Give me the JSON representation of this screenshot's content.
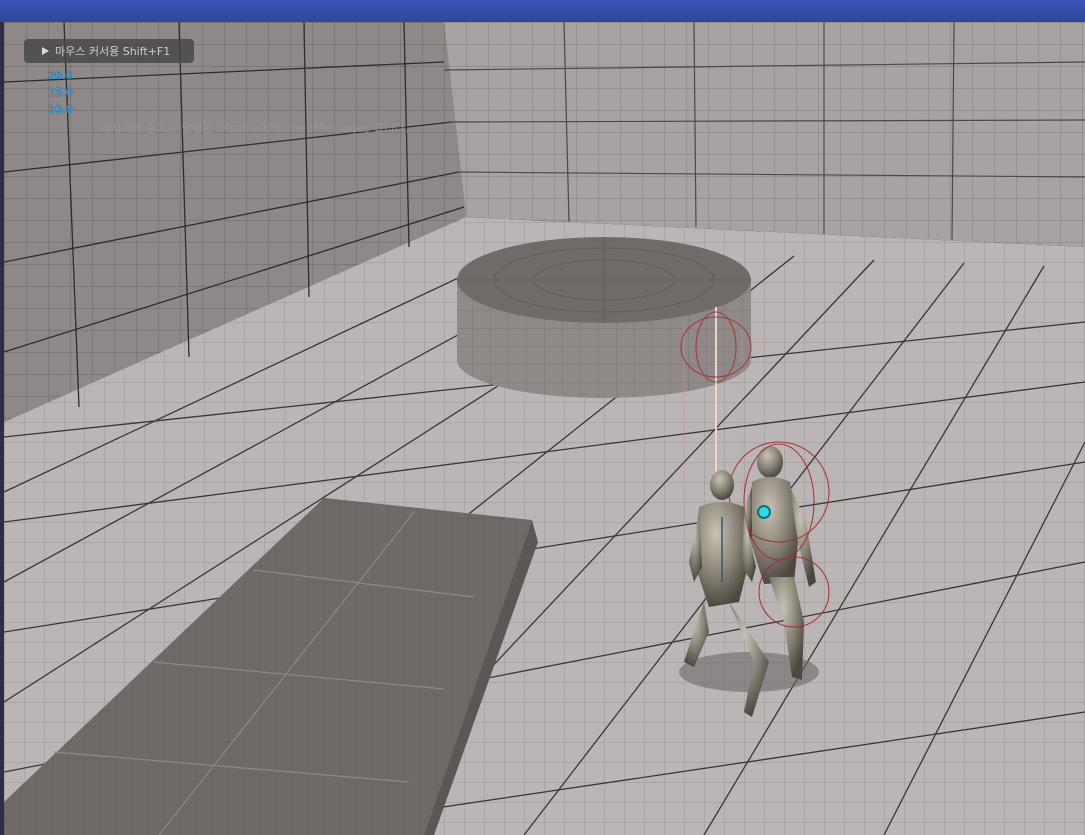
{
  "overlay": {
    "cursor_hint": "마우스 커서용 Shift+F1",
    "stats": [
      "20.0",
      "15.0",
      "10.0"
    ],
    "screen_message": "메시지를 숨기는 명령은 DisableAllScreenMessages 입니다."
  },
  "colors": {
    "title_bar": "#2e479c",
    "stat_text": "#23b7ff",
    "floor": "#b8b2b2",
    "wall": "#9a9494",
    "block": "#6f6a68",
    "mannequin": "#8a8478",
    "debug_capsule": "#a32b38",
    "chest_glow": "#35d6e6"
  }
}
